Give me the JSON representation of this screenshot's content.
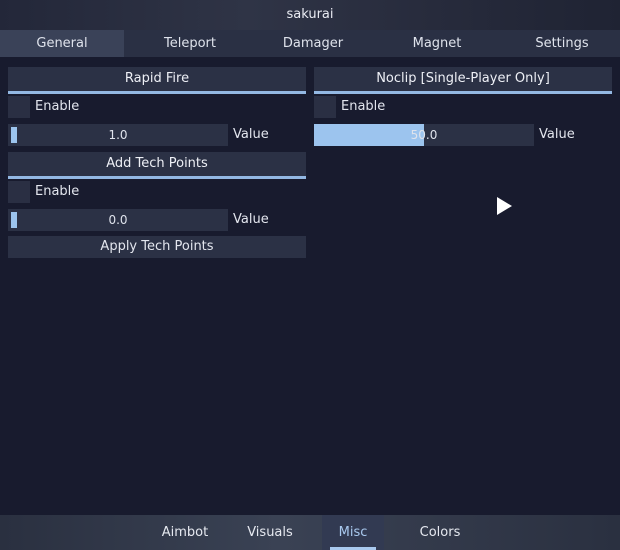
{
  "window": {
    "title": "sakurai"
  },
  "tabs": [
    {
      "label": "General",
      "active": true
    },
    {
      "label": "Teleport",
      "active": false
    },
    {
      "label": "Damager",
      "active": false
    },
    {
      "label": "Magnet",
      "active": false
    },
    {
      "label": "Settings",
      "active": false
    }
  ],
  "left": {
    "rapid_fire": {
      "title": "Rapid Fire",
      "enable_label": "Enable",
      "slider_value": "1.0",
      "slider_label": "Value"
    },
    "tech_points": {
      "title": "Add Tech Points",
      "enable_label": "Enable",
      "slider_value": "0.0",
      "slider_label": "Value",
      "apply_label": "Apply Tech Points"
    }
  },
  "right": {
    "noclip": {
      "title": "Noclip [Single-Player Only]",
      "enable_label": "Enable",
      "slider_value": "50.0",
      "slider_label": "Value",
      "slider_fill": 0.5
    }
  },
  "bottom_tabs": [
    {
      "label": "Aimbot",
      "active": false
    },
    {
      "label": "Visuals",
      "active": false
    },
    {
      "label": "Misc",
      "active": true
    },
    {
      "label": "Colors",
      "active": false
    }
  ],
  "colors": {
    "accent": "#93b8e3",
    "background": "#181b2e",
    "panel": "#2b3145"
  }
}
